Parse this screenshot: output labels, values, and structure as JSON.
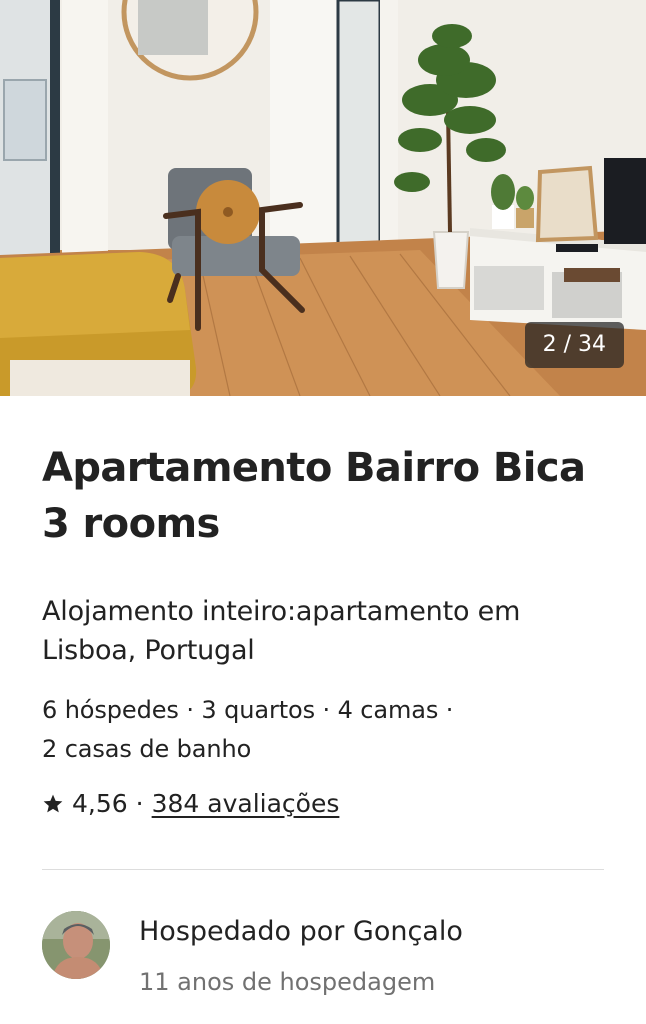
{
  "gallery": {
    "counter": "2 / 34"
  },
  "listing": {
    "title": "Apartamento Bairro Bica 3 rooms",
    "subtitle": "Alojamento inteiro:apartamento em Lisboa, Portugal",
    "details_line1": "6 hóspedes · 3 quartos · 4 camas ·",
    "details_line2": "2 casas de banho",
    "rating": "4,56",
    "rating_separator": "·",
    "reviews_link": "384 avaliações"
  },
  "host": {
    "name": "Hospedado por Gonçalo",
    "experience": "11 anos de hospedagem"
  },
  "colors": {
    "text_primary": "#222222",
    "text_secondary": "#717171",
    "divider": "#dddddd"
  }
}
